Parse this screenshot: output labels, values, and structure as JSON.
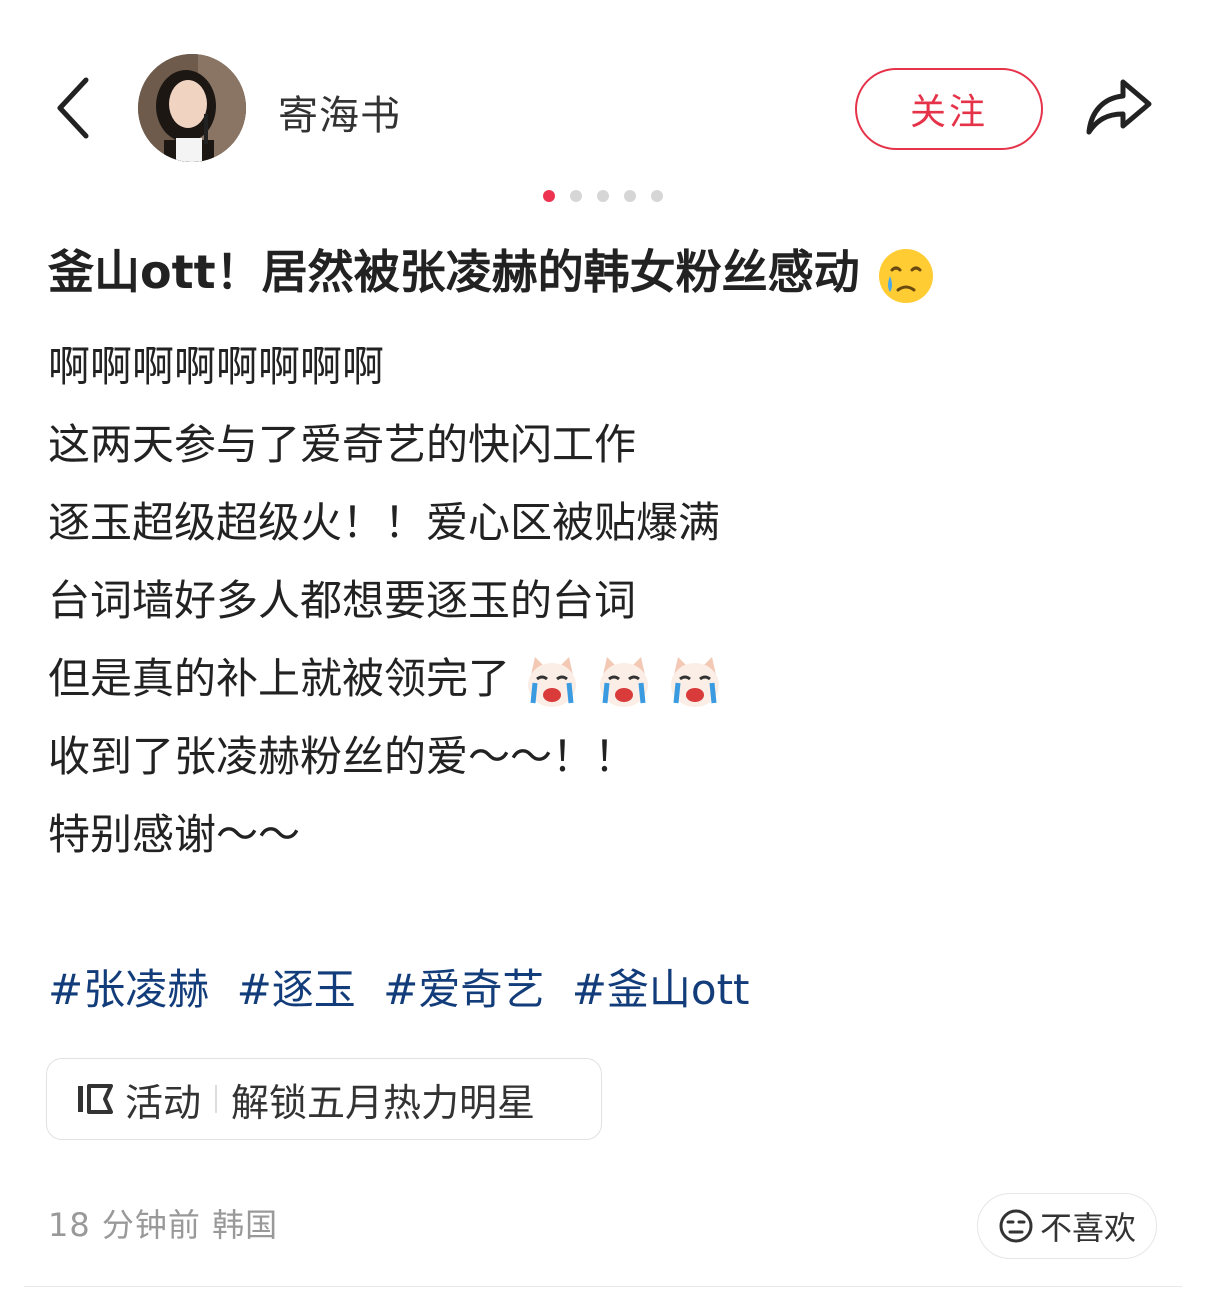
{
  "header": {
    "username": "寄海书",
    "follow_label": "关注"
  },
  "carousel": {
    "total": 5,
    "active_index": 0
  },
  "post": {
    "title": "釜山ott！居然被张凌赫的韩女粉丝感动",
    "lines": [
      "啊啊啊啊啊啊啊啊",
      "这两天参与了爱奇艺的快闪工作",
      "逐玉超级超级火！！爱心区被贴爆满",
      "台词墙好多人都想要逐玉的台词",
      "但是真的补上就被领完了",
      "收到了张凌赫粉丝的爱～～！！",
      "特别感谢～～"
    ],
    "tags": [
      "#张凌赫",
      "#逐玉",
      "#爱奇艺",
      "#釜山ott"
    ]
  },
  "activity": {
    "label": "活动",
    "text": "解锁五月热力明星"
  },
  "meta": {
    "time_location": "18 分钟前 韩国"
  },
  "dislike": {
    "label": "不喜欢"
  },
  "icons": {
    "back": "back-chevron-icon",
    "share": "share-arrow-icon",
    "title_emoji": "crying-face-emoji",
    "cry_emoji": "crying-dog-emoji",
    "activity": "activity-tag-icon",
    "dislike": "neutral-face-icon"
  },
  "colors": {
    "accent": "#e5334a",
    "tag": "#133d7a",
    "meta": "#999999"
  }
}
